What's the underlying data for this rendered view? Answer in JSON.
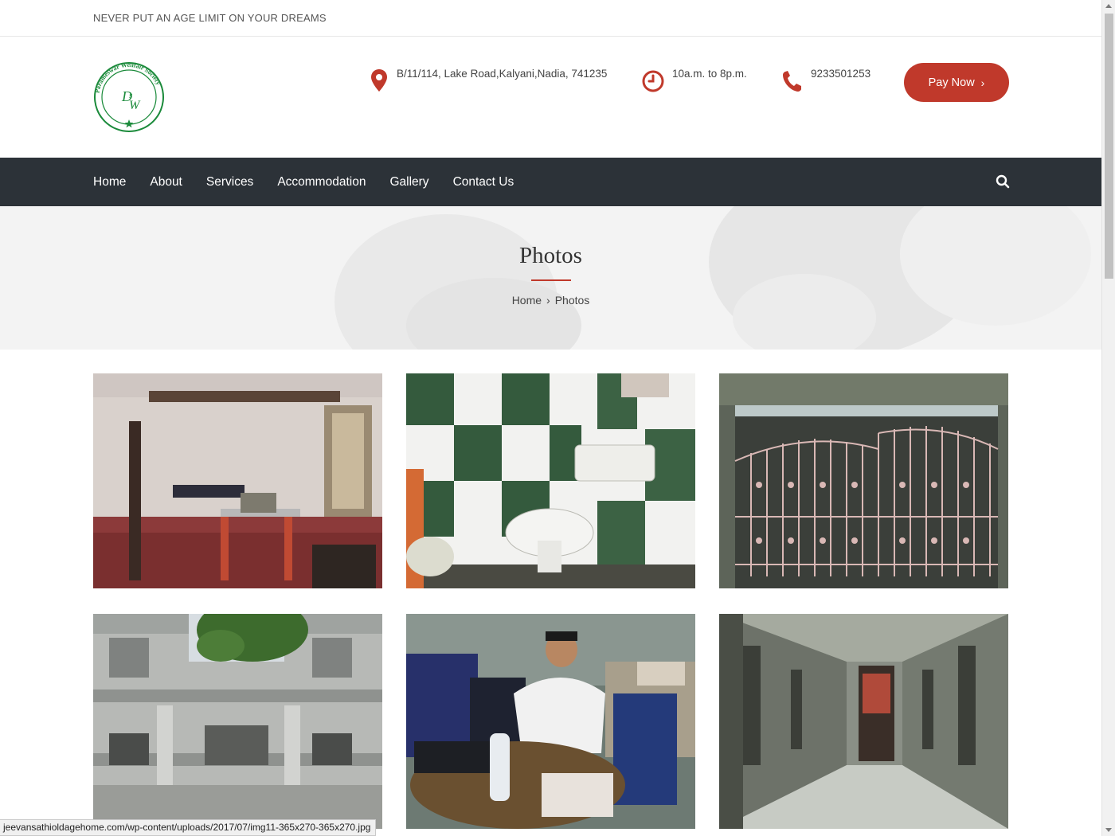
{
  "topbar": {
    "tagline": "NEVER PUT AN AGE LIMIT ON YOUR DREAMS"
  },
  "header": {
    "logo": {
      "ring_text": "Parameswar Wellfair Society",
      "icon": "pws-logo"
    },
    "address": {
      "icon": "map-pin-icon",
      "text": "B/11/114, Lake Road,Kalyani,Nadia, 741235"
    },
    "hours": {
      "icon": "clock-icon",
      "text": "10a.m. to 8p.m."
    },
    "phone": {
      "icon": "phone-icon",
      "text": "9233501253"
    },
    "pay_button": {
      "label": "Pay Now",
      "icon": "chevron-right-icon"
    }
  },
  "nav": {
    "items": [
      {
        "label": "Home"
      },
      {
        "label": "About"
      },
      {
        "label": "Services"
      },
      {
        "label": "Accommodation"
      },
      {
        "label": "Gallery"
      },
      {
        "label": "Contact Us"
      }
    ],
    "search_icon": "search-icon"
  },
  "banner": {
    "title": "Photos",
    "breadcrumb": {
      "home": "Home",
      "separator": "›",
      "current": "Photos"
    }
  },
  "gallery": {
    "photos": [
      {
        "subject": "room-with-bed-and-desk"
      },
      {
        "subject": "tiled-bathroom-toilet"
      },
      {
        "subject": "iron-gate-entrance"
      },
      {
        "subject": "building-facade"
      },
      {
        "subject": "man-at-office-desk"
      },
      {
        "subject": "corridor"
      }
    ]
  },
  "statusbar": {
    "url": "jeevansathioldagehome.com/wp-content/uploads/2017/07/img11-365x270-365x270.jpg"
  },
  "colors": {
    "accent": "#c0392b",
    "nav_bg": "#2c3238",
    "logo_green": "#1a8a3a",
    "banner_bg": "#f3f3f3"
  }
}
